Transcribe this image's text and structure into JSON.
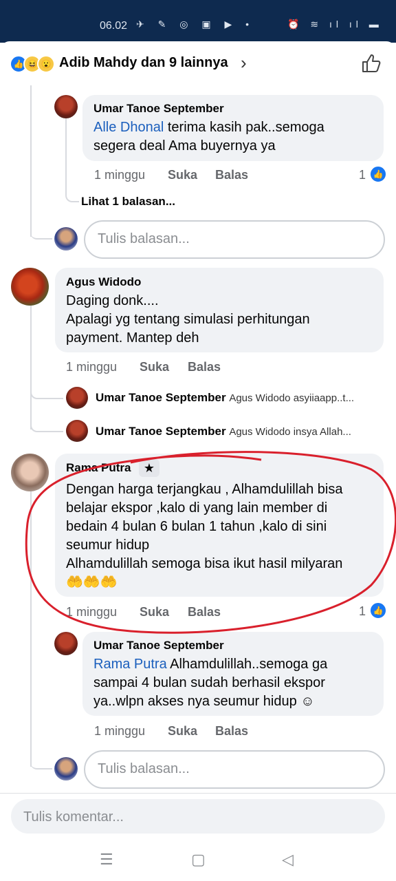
{
  "status": {
    "time": "06.02",
    "left_icons": "✈ ✎ ◎ ▣ ▶ •",
    "right_icons": "⏰ ≋ ıl ıl ▬"
  },
  "header": {
    "title": "Adib Mahdy dan 9 lainnya"
  },
  "comments": [
    {
      "author": "Umar Tanoe September",
      "mention": "Alle Dhonal",
      "line1_rest": " terima kasih pak..semoga",
      "line2": "segera deal Ama buyernya ya",
      "time": "1 minggu",
      "like": "Suka",
      "reply": "Balas",
      "likes": "1",
      "view_replies": "Lihat 1 balasan..."
    },
    {
      "author": "Agus Widodo",
      "lines": [
        "Daging donk....",
        "Apalagi yg tentang simulasi perhitungan",
        "payment. Mantep deh"
      ],
      "time": "1 minggu",
      "like": "Suka",
      "reply": "Balas",
      "replies": [
        {
          "author": "Umar Tanoe September",
          "text": "Agus Widodo asyiiaapp..t..."
        },
        {
          "author": "Umar Tanoe September",
          "text": "Agus Widodo insya Allah..."
        }
      ]
    },
    {
      "author": "Rama Putra",
      "lines": [
        "Dengan harga terjangkau , Alhamdulillah bisa",
        "belajar ekspor ,kalo di yang lain member di",
        "bedain 4 bulan 6 bulan 1 tahun ,kalo di sini",
        "seumur hidup",
        "Alhamdulillah semoga bisa ikut hasil milyaran"
      ],
      "emoji": "🤲🤲🤲",
      "time": "1 minggu",
      "like": "Suka",
      "reply": "Balas",
      "likes": "1"
    },
    {
      "author": "Umar Tanoe September",
      "mention": "Rama Putra",
      "line1_rest": " Alhamdulillah..semoga ga",
      "line2": "sampai 4 bulan sudah berhasil ekspor",
      "line3": "ya..wlpn akses nya seumur hidup ☺",
      "time": "1 minggu",
      "like": "Suka",
      "reply": "Balas"
    }
  ],
  "reply_placeholder": "Tulis balasan...",
  "comment_placeholder": "Tulis komentar...",
  "nav": {
    "menu": "☰",
    "home": "▢",
    "back": "◁"
  },
  "colors": {
    "status_bar": "#0e2a4f",
    "link": "#1b5fbd",
    "highlight_circle": "#d9202c"
  }
}
